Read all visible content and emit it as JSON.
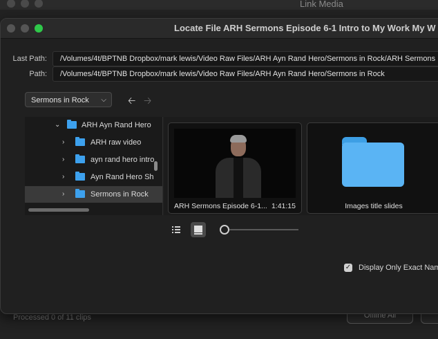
{
  "background_window": {
    "title": "Link Media",
    "status": "Processed 0 of 11 clips",
    "offline_all_label": "Offline All"
  },
  "dialog": {
    "title": "Locate File ARH Sermons Episode 6-1 Intro to My Work My W",
    "last_path_label": "Last Path:",
    "last_path_value": "/Volumes/4t/BPTNB Dropbox/mark lewis/Video Raw Files/ARH Ayn Rand Hero/Sermons in Rock/ARH Sermons E",
    "path_label": "Path:",
    "path_value": "/Volumes/4t/BPTNB Dropbox/mark lewis/Video Raw Files/ARH Ayn Rand Hero/Sermons in Rock",
    "location_dropdown": "Sermons in Rock",
    "tree": [
      {
        "label": "ARH Ayn Rand Hero",
        "expanded": true
      },
      {
        "label": "ARH raw video",
        "expanded": false
      },
      {
        "label": "ayn rand hero intro",
        "expanded": false
      },
      {
        "label": "Ayn Rand Hero Sh",
        "expanded": false
      },
      {
        "label": "Sermons in Rock",
        "expanded": false,
        "selected": true
      }
    ],
    "tiles": [
      {
        "label": "ARH Sermons Episode 6-1...",
        "duration": "1:41:15"
      },
      {
        "label": "Images title slides"
      }
    ],
    "display_only_exact_label": "Display Only Exact Nam",
    "display_only_exact_checked": true,
    "accent_folder_color": "#3da1ee"
  }
}
